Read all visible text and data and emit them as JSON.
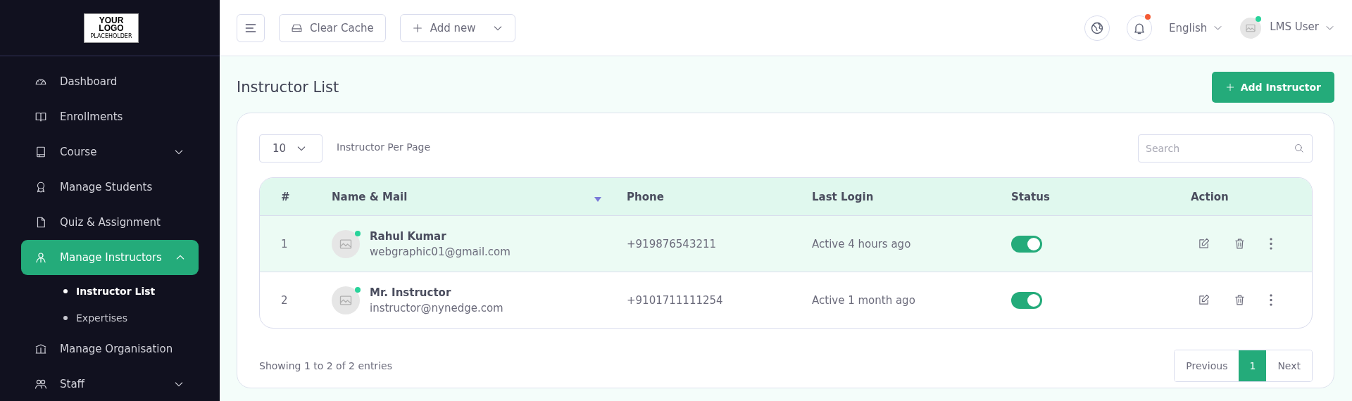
{
  "logo": {
    "lines": [
      "YOUR",
      "LOGO"
    ],
    "tagline": "PLACEHOLDER"
  },
  "sidebar": {
    "items": [
      {
        "label": "Dashboard",
        "kind": "link",
        "selected": false
      },
      {
        "label": "Enrollments",
        "kind": "link",
        "selected": false
      },
      {
        "label": "Course",
        "kind": "group",
        "expanded": false,
        "selected": false
      },
      {
        "label": "Manage Students",
        "kind": "link",
        "selected": false
      },
      {
        "label": "Quiz & Assignment",
        "kind": "link",
        "selected": false
      },
      {
        "label": "Manage Instructors",
        "kind": "group",
        "expanded": true,
        "selected": true,
        "children": [
          {
            "label": "Instructor List",
            "selected": true
          },
          {
            "label": "Expertises",
            "selected": false
          }
        ]
      },
      {
        "label": "Manage Organisation",
        "kind": "link",
        "selected": false
      },
      {
        "label": "Staff",
        "kind": "group",
        "expanded": false,
        "selected": false
      }
    ]
  },
  "topbar": {
    "clear_cache": "Clear Cache",
    "add_new": "Add new",
    "notifications_unread": true,
    "language": "English",
    "user": {
      "name": "LMS User",
      "online": true
    }
  },
  "page": {
    "title": "Instructor List",
    "add_button": "Add Instructor"
  },
  "list": {
    "per_page": "10",
    "per_page_label": "Instructor Per Page",
    "search_placeholder": "Search"
  },
  "table": {
    "columns": [
      {
        "label": "#",
        "sortable": false
      },
      {
        "label": "Name & Mail",
        "sortable": true
      },
      {
        "label": "Phone",
        "sortable": false
      },
      {
        "label": "Last Login",
        "sortable": false
      },
      {
        "label": "Status",
        "sortable": false
      },
      {
        "label": "Action",
        "sortable": false
      }
    ],
    "rows": [
      {
        "number": "1",
        "name": "Rahul Kumar",
        "email": "webgraphic01@gmail.com",
        "online": true,
        "phone": "+919876543211",
        "last_login": "Active 4 hours ago",
        "status_on": true,
        "selected": true
      },
      {
        "number": "2",
        "name": "Mr. Instructor",
        "email": "instructor@nynedge.com",
        "online": true,
        "phone": "+9101711111254",
        "last_login": "Active 1 month ago",
        "status_on": true,
        "selected": false
      }
    ]
  },
  "footer": {
    "summary": "Showing 1 to 2 of 2 entries",
    "previous": "Previous",
    "pages": [
      {
        "label": "1",
        "selected": true
      }
    ],
    "next": "Next"
  }
}
